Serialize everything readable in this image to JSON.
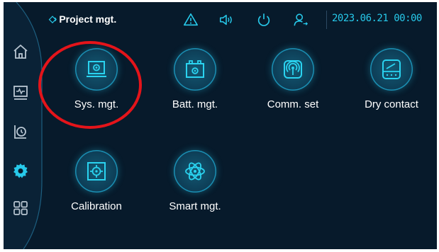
{
  "header": {
    "title": "Project mgt.",
    "title_icon": "double-chevron-right-icon",
    "datetime": "2023.06.21 00:00",
    "icons": [
      "warning-icon",
      "speaker-icon",
      "power-icon",
      "user-switch-icon"
    ]
  },
  "sidebar": {
    "items": [
      {
        "name": "home",
        "icon": "home-icon",
        "active": false
      },
      {
        "name": "monitor",
        "icon": "monitor-icon",
        "active": false
      },
      {
        "name": "history",
        "icon": "history-icon",
        "active": false
      },
      {
        "name": "settings",
        "icon": "gear-icon",
        "active": true
      },
      {
        "name": "apps",
        "icon": "grid-icon",
        "active": false
      }
    ]
  },
  "main": {
    "tiles": [
      {
        "label": "Sys. mgt.",
        "icon": "system-settings-icon"
      },
      {
        "label": "Batt. mgt.",
        "icon": "battery-settings-icon"
      },
      {
        "label": "Comm. set",
        "icon": "communication-icon"
      },
      {
        "label": "Dry contact",
        "icon": "dry-contact-icon"
      },
      {
        "label": "Calibration",
        "icon": "calibration-icon"
      },
      {
        "label": "Smart mgt.",
        "icon": "atom-icon"
      }
    ]
  },
  "colors": {
    "background": "#071a2b",
    "accent": "#27c9ea",
    "text": "#ffffff",
    "highlight": "#e4141a",
    "tile_fill": "#0d3c55"
  }
}
